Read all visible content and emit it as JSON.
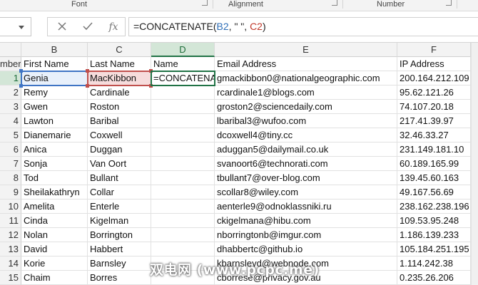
{
  "ribbon": {
    "groups": [
      "Font",
      "Alignment",
      "Number"
    ]
  },
  "formula_bar": {
    "name_box": "",
    "cancel_icon": "x-icon",
    "enter_icon": "check-icon",
    "fx_label": "fx",
    "formula_prefix": "=CONCATENATE(",
    "formula_ref1": "B2",
    "formula_mid": ", \" \", ",
    "formula_ref2": "C2",
    "formula_suffix": ")"
  },
  "sheet": {
    "column_headers": [
      "B",
      "C",
      "D",
      "E",
      "F"
    ],
    "selected_column": "D",
    "header_row": {
      "num": "mber",
      "first": "First Name",
      "last": "Last Name",
      "name": "Name",
      "email": "Email Address",
      "ip": "IP Address"
    },
    "rows": [
      {
        "num": "1",
        "first": "Genia",
        "last": "MacKibbon",
        "name": "=CONCATENA",
        "email": "gmackibbon0@nationalgeographic.com",
        "ip": "200.164.212.109"
      },
      {
        "num": "2",
        "first": "Remy",
        "last": "Cardinale",
        "name": "",
        "email": "rcardinale1@blogs.com",
        "ip": "95.62.121.26"
      },
      {
        "num": "3",
        "first": "Gwen",
        "last": "Roston",
        "name": "",
        "email": "groston2@sciencedaily.com",
        "ip": "74.107.20.18"
      },
      {
        "num": "4",
        "first": "Lawton",
        "last": "Baribal",
        "name": "",
        "email": "lbaribal3@wufoo.com",
        "ip": "217.41.39.97"
      },
      {
        "num": "5",
        "first": "Dianemarie",
        "last": "Coxwell",
        "name": "",
        "email": "dcoxwell4@tiny.cc",
        "ip": "32.46.33.27"
      },
      {
        "num": "6",
        "first": "Anica",
        "last": "Duggan",
        "name": "",
        "email": "aduggan5@dailymail.co.uk",
        "ip": "231.149.181.10"
      },
      {
        "num": "7",
        "first": "Sonja",
        "last": "Van Oort",
        "name": "",
        "email": "svanoort6@technorati.com",
        "ip": "60.189.165.99"
      },
      {
        "num": "8",
        "first": "Tod",
        "last": "Bullant",
        "name": "",
        "email": "tbullant7@over-blog.com",
        "ip": "139.45.60.163"
      },
      {
        "num": "9",
        "first": "Sheilakathryn",
        "last": "Collar",
        "name": "",
        "email": "scollar8@wiley.com",
        "ip": "49.167.56.69"
      },
      {
        "num": "10",
        "first": "Amelita",
        "last": "Enterle",
        "name": "",
        "email": "aenterle9@odnoklassniki.ru",
        "ip": "238.162.238.196"
      },
      {
        "num": "11",
        "first": "Cinda",
        "last": "Kigelman",
        "name": "",
        "email": "ckigelmana@hibu.com",
        "ip": "109.53.95.248"
      },
      {
        "num": "12",
        "first": "Nolan",
        "last": "Borrington",
        "name": "",
        "email": "nborringtonb@imgur.com",
        "ip": "1.186.139.233"
      },
      {
        "num": "13",
        "first": "David",
        "last": "Habbert",
        "name": "",
        "email": "dhabbertc@github.io",
        "ip": "105.184.251.195"
      },
      {
        "num": "14",
        "first": "Korie",
        "last": "Barnsley",
        "name": "",
        "email": "kbarnsleyd@webnode.com",
        "ip": "1.114.242.38"
      },
      {
        "num": "15",
        "first": "Chaim",
        "last": "Borres",
        "name": "",
        "email": "cborrese@privacy.gov.au",
        "ip": "0.235.26.206"
      }
    ]
  },
  "watermark": "双电网 (www.pcpc.me)",
  "colors": {
    "accent_green": "#217346",
    "ref_blue": "#3f74c4",
    "ref_red": "#c0504d"
  }
}
